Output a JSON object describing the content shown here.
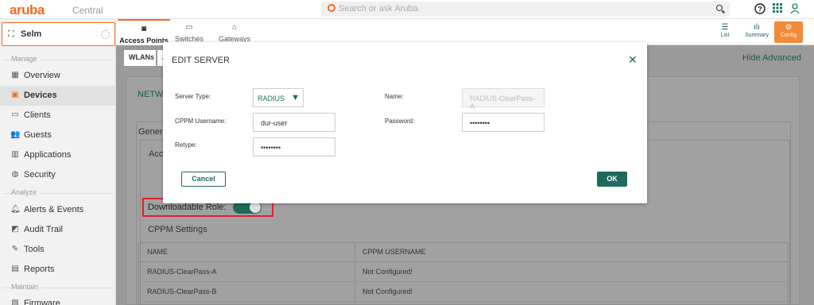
{
  "header": {
    "logo": "aruba",
    "product": "Central",
    "search_placeholder": "Search or ask Aruba",
    "icons": [
      "search-icon",
      "help-icon",
      "apps-grid-icon",
      "user-icon"
    ]
  },
  "sidebar": {
    "site": "Selm",
    "sections": {
      "manage": "Manage",
      "analyze": "Analyze",
      "maintain": "Maintain"
    },
    "items": [
      {
        "label": "Overview",
        "icon": "overview-icon"
      },
      {
        "label": "Devices",
        "icon": "devices-icon",
        "active": true
      },
      {
        "label": "Clients",
        "icon": "clients-icon"
      },
      {
        "label": "Guests",
        "icon": "guests-icon"
      },
      {
        "label": "Applications",
        "icon": "applications-icon"
      },
      {
        "label": "Security",
        "icon": "security-icon"
      },
      {
        "label": "Alerts & Events",
        "icon": "bell-icon"
      },
      {
        "label": "Audit Trail",
        "icon": "audit-icon"
      },
      {
        "label": "Tools",
        "icon": "wrench-icon"
      },
      {
        "label": "Reports",
        "icon": "reports-icon"
      },
      {
        "label": "Firmware",
        "icon": "firmware-icon"
      }
    ]
  },
  "tabs": [
    {
      "label": "Access Points",
      "active": true
    },
    {
      "label": "Switches"
    },
    {
      "label": "Gateways"
    }
  ],
  "right_tabs": [
    {
      "label": "List"
    },
    {
      "label": "Summary"
    },
    {
      "label": "Config",
      "active": true
    }
  ],
  "subtabs": [
    "WLANs",
    "A"
  ],
  "hide_advanced": "Hide Advanced",
  "section_title": "NETWO",
  "general_label": "Genera",
  "access_label": "Acce",
  "downloadable_role_label": "Downloadable Role:",
  "downloadable_role_on": true,
  "cppm_settings_label": "CPPM Settings",
  "table": {
    "headers": [
      "NAME",
      "CPPM USERNAME"
    ],
    "rows": [
      [
        "RADIUS-ClearPass-A",
        "Not Configured!"
      ],
      [
        "RADIUS-ClearPass-B",
        "Not Configured!"
      ]
    ]
  },
  "modal": {
    "title": "EDIT SERVER",
    "server_type_label": "Server Type:",
    "server_type_value": "RADIUS",
    "name_label": "Name:",
    "name_value": "RADIUS-ClearPass-A",
    "cppm_username_label": "CPPM Username:",
    "cppm_username_value": "dur-user",
    "password_label": "Password:",
    "password_value": "••••••••",
    "retype_label": "Retype:",
    "retype_value": "••••••••",
    "cancel_label": "Cancel",
    "ok_label": "OK"
  },
  "colors": {
    "brand": "#f26b21",
    "accent": "#1f6a5c",
    "highlight_border": "#e0202e"
  }
}
